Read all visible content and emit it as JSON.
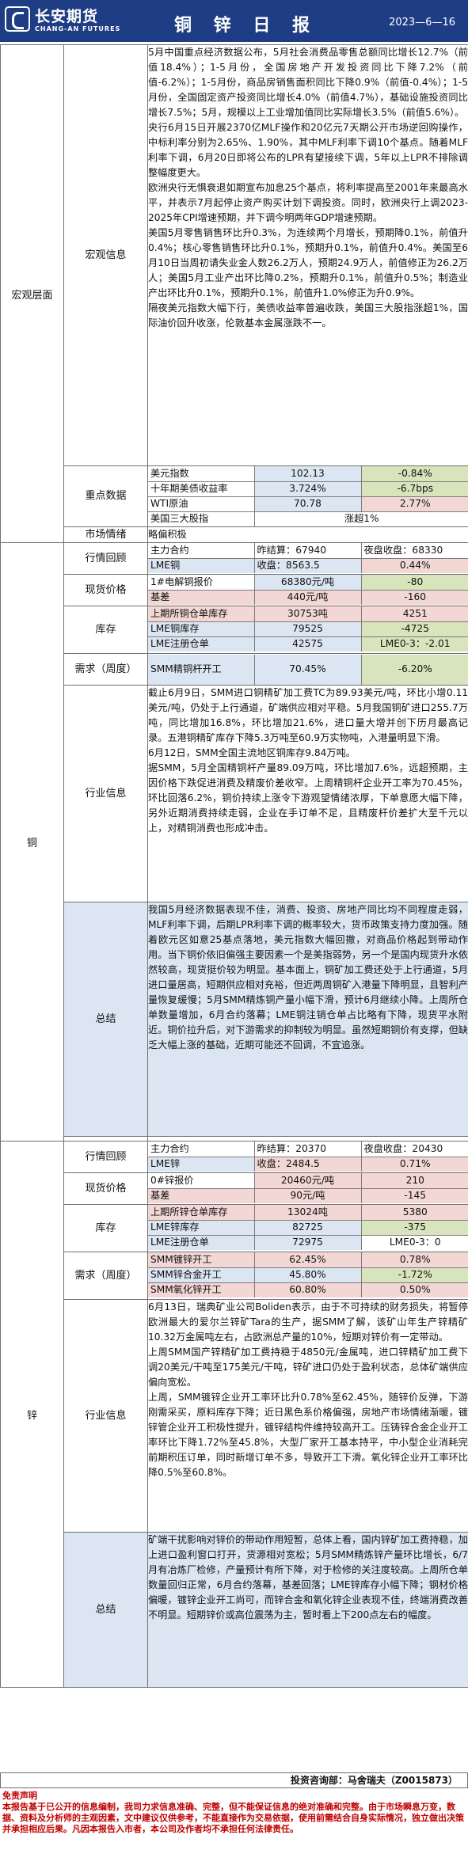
{
  "header": {
    "logo_cn": "长安期货",
    "logo_en": "CHANG-AN FUTURES",
    "title": "铜 锌 日 报",
    "date": "2023—6—16"
  },
  "macro": {
    "section": "宏观层面",
    "info_label": "宏观信息",
    "info_text": "5月中国重点经济数据公布，5月社会消费品零售总额同比增长12.7%（前值18.4%）；1-5月份，全国房地产开发投资同比下降7.2%（前值-6.2%）；1-5月份，商品房销售面积同比下降0.9%（前值-0.4%）；1-5月份，全国固定资产投资同比增长4.0%（前值4.7%），基础设施投资同比增长7.5%；5月，规模以上工业增加值同比实际增长3.5%（前值5.6%）。\n央行6月15日开展2370亿MLF操作和20亿元7天期公开市场逆回购操作，中标利率分别为2.65%、1.90%，其中MLF利率下调10个基点。随着MLF利率下调，6月20日即将公布的LPR有望接续下调，5年以上LPR不排除调整幅度更大。\n欧洲央行无惧衰退如期宣布加息25个基点，将利率提高至2001年来最高水平，并表示7月起停止资产购买计划下调投资。同时，欧洲央行上调2023-2025年CPI增速预期，并下调今明两年GDP增速预期。\n美国5月零售销售环比升0.3%，为连续两个月增长，预期降0.1%，前值升0.4%；核心零售销售环比升0.1%，预期升0.1%，前值升0.4%。美国至6月10日当周初请失业金人数26.2万人，预期24.9万人，前值修正为26.2万人；美国5月工业产出环比降0.2%，预期升0.1%，前值升0.5%；制造业产出环比升0.1%，预期升0.1%，前值升1.0%修正为升0.9%。\n隔夜美元指数大幅下行，美债收益率普遍收跌，美国三大股指涨超1%，国际油价回升收涨，伦敦基本金属涨跌不一。",
    "key_label": "重点数据",
    "key_rows": [
      {
        "name": "美元指数",
        "val": "102.13",
        "chg": "-0.84%"
      },
      {
        "name": "十年期美债收益率",
        "val": "3.724%",
        "chg": "-6.7bps"
      },
      {
        "name": "WTI原油",
        "val": "70.78",
        "chg": "2.77%"
      },
      {
        "name": "美国三大股指",
        "val": "",
        "chg": "涨超1%"
      }
    ],
    "mood_label": "市场情绪",
    "mood_value": "略偏积极"
  },
  "copper": {
    "section": "铜",
    "review_label": "行情回顾",
    "review_rows": [
      {
        "name": "主力合约",
        "a": "昨结算：67940",
        "b": "夜盘收盘：68330"
      },
      {
        "name": "LME铜",
        "a": "收盘：8563.5",
        "b": "0.44%"
      }
    ],
    "spot_label": "现货价格",
    "spot_rows": [
      {
        "name": "1#电解铜报价",
        "a": "68380元/吨",
        "b": "-80"
      },
      {
        "name": "基差",
        "a": "440元/吨",
        "b": "-160"
      }
    ],
    "stock_label": "库存",
    "stock_rows": [
      {
        "name": "上期所铜仓单库存",
        "a": "30753吨",
        "b": "4251"
      },
      {
        "name": "LME铜库存",
        "a": "79525",
        "b": "-4725"
      },
      {
        "name": "LME注册仓单",
        "a": "42575",
        "b": "LME0-3：-2.01"
      }
    ],
    "demand_label": "需求（周度）",
    "demand_rows": [
      {
        "name": "SMM精铜杆开工",
        "a": "70.45%",
        "b": "-6.20%"
      }
    ],
    "industry_label": "行业信息",
    "industry_text": "截止6月9日，SMM进口铜精矿加工费TC为89.93美元/吨，环比小增0.11美元/吨，仍处于上行通道，矿端供应相对平稳。5月我国铜矿进口255.7万吨，同比增加16.8%，环比增加21.6%，进口量大增并创下历月最高记录。五港铜精矿库存下降5.3万吨至60.9万实物吨，入港量明显下滑。\n6月12日，SMM全国主流地区铜库存9.84万吨。\n据SMM，5月全国精铜杆产量89.09万吨，环比增加7.6%，远超预期，主因价格下跌促进消费及精废价差收窄。上周精铜杆企业开工率为70.45%，环比回落6.2%，铜价持续上涨令下游观望情绪浓厚，下单意愿大幅下降，另外近期消费持续走弱，企业在手订单不足，且精废杆价差扩大至千元以上，对精铜消费也形成冲击。",
    "summary_label": "总结",
    "summary_text": "我国5月经济数据表现不佳，消费、投资、房地产同比均不同程度走弱，MLF利率下调，后期LPR利率下调的概率较大，货币政策支持力度加强。随着欧元区如意25基点落地，美元指数大幅回撤，对商品价格起到带动作用。当下铜价依旧偏强主要因素一个是美指弱势，另一个是国内现货升水依然较高，现货挺价较为明显。基本面上，铜矿加工费还处于上行通道，5月进口量居高，短期供应相对充裕，但近两周铜矿入港量下降明显，且智利产量恢复缓慢；5月SMM精炼铜产量小幅下滑，预计6月继续小降。上周所仓单数量增加，6月合约落幕；LME铜注销仓单占比略有下降，现货平水附近。铜价拉升后，对下游需求的抑制较为明显。虽然短期铜价有支撑，但缺乏大幅上涨的基础，近期可能还不回调，不宜追涨。"
  },
  "zinc": {
    "section": "锌",
    "review_label": "行情回顾",
    "review_rows": [
      {
        "name": "主力合约",
        "a": "昨结算：20370",
        "b": "夜盘收盘：20430"
      },
      {
        "name": "LME锌",
        "a": "收盘：2484.5",
        "b": "0.71%"
      }
    ],
    "spot_label": "现货价格",
    "spot_rows": [
      {
        "name": "0#锌报价",
        "a": "20460元/吨",
        "b": "210"
      },
      {
        "name": "基差",
        "a": "90元/吨",
        "b": "-145"
      }
    ],
    "stock_label": "库存",
    "stock_rows": [
      {
        "name": "上期所锌仓单库存",
        "a": "13024吨",
        "b": "5380"
      },
      {
        "name": "LME锌库存",
        "a": "82725",
        "b": "-375"
      },
      {
        "name": "LME注册仓单",
        "a": "72975",
        "b": "LME0-3：0"
      }
    ],
    "demand_label": "需求（周度）",
    "demand_rows": [
      {
        "name": "SMM镀锌开工",
        "a": "62.45%",
        "b": "0.78%"
      },
      {
        "name": "SMM锌合金开工",
        "a": "45.80%",
        "b": "-1.72%"
      },
      {
        "name": "SMM氧化锌开工",
        "a": "60.80%",
        "b": "0.50%"
      }
    ],
    "industry_label": "行业信息",
    "industry_text": "6月13日，瑞典矿业公司Boliden表示，由于不可持续的财务损失，将暂停欧洲最大的爱尔兰锌矿Tara的生产，据SMM了解，该矿山年生产锌精矿10.32万金属吨左右，占欧洲总产量的10%，短期对锌价有一定带动。\n上周SMM国产锌精矿加工费持稳于4850元/金属吨，进口锌精矿加工费下调20美元/干吨至175美元/干吨，锌矿进口仍处于盈利状态，总体矿端供应偏向宽松。\n上周，SMM镀锌企业开工率环比升0.78%至62.45%，随锌价反弹，下游刚需采买，原料库存下降；近日黑色系价格偏强，房地产市场情绪渐暖，镀锌管企业开工积极性提升，镀锌结构件维持较高开工。压铸锌合金企业开工率环比下降1.72%至45.8%，大型厂家开工基本持平，中小型企业消耗完前期积压订单，同时新增订单不多，导致开工下滑。氧化锌企业开工率环比降0.5%至60.8%。",
    "summary_label": "总结",
    "summary_text": "矿端干扰影响对锌价的带动作用短暂，总体上看，国内锌矿加工费持稳，加上进口盈利窗口打开，货源相对宽松；5月SMM精炼锌产量环比增长，6/7月有冶炼厂检修，产量预计有所下降，对于检修的关注度较高。上周所仓单数量回归正常，6月合约落幕，基差回落；LME锌库存小幅下降；钢材价格偏暖，镀锌企业开工尚可，而锌合金和氧化锌企业表现不佳，终端消费改善不明显。短期锌价或高位震荡为主，暂时看上下200点左右的幅度。"
  },
  "footer": {
    "analyst": "投资咨询部：马舍瑞夫（Z0015873）",
    "disclaimer_title": "免责声明",
    "disclaimer": "本报告基于已公开的信息编制，我司力求信息准确、完整，但不能保证信息的绝对准确和完整。由于市场瞬息万变，数据、资料及分析师的主观因素，文中建议仅供参考，不能直接作为交易依据，使用前需结合自身实际情况，独立做出决策并承担相应后果。凡因本报告入市者，本公司及作者均不承担任何法律责任。"
  },
  "colors": {
    "header_bg": "#1e3d84",
    "light_blue": "#dce6f2",
    "green": "#d7e4bc",
    "pink": "#f2d7d5",
    "yellow": "#ffff00",
    "disclaimer_red": "#c00000"
  }
}
